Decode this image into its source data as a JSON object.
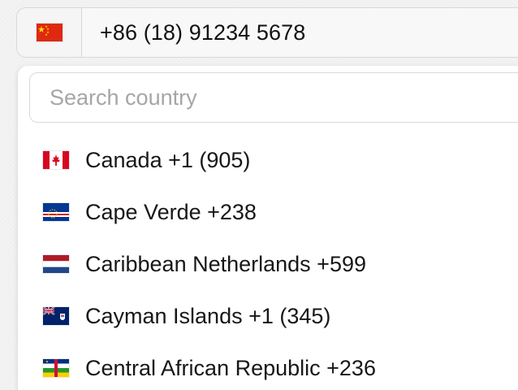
{
  "phone": {
    "selected_flag_icon": "china-flag-icon",
    "value": "+86 (18) 91234 5678"
  },
  "dropdown": {
    "search_placeholder": "Search country",
    "search_value": "",
    "countries": [
      {
        "label": "Canada +1 (905)",
        "flag_icon": "canada-flag-icon"
      },
      {
        "label": "Cape Verde +238",
        "flag_icon": "cape-verde-flag-icon"
      },
      {
        "label": "Caribbean Netherlands +599",
        "flag_icon": "caribbean-netherlands-flag-icon"
      },
      {
        "label": "Cayman Islands +1 (345)",
        "flag_icon": "cayman-islands-flag-icon"
      },
      {
        "label": "Central African Republic +236",
        "flag_icon": "central-african-republic-flag-icon"
      }
    ]
  },
  "colors": {
    "input_border": "#d8d8db",
    "placeholder": "#a6a6a8",
    "text": "#171717"
  }
}
